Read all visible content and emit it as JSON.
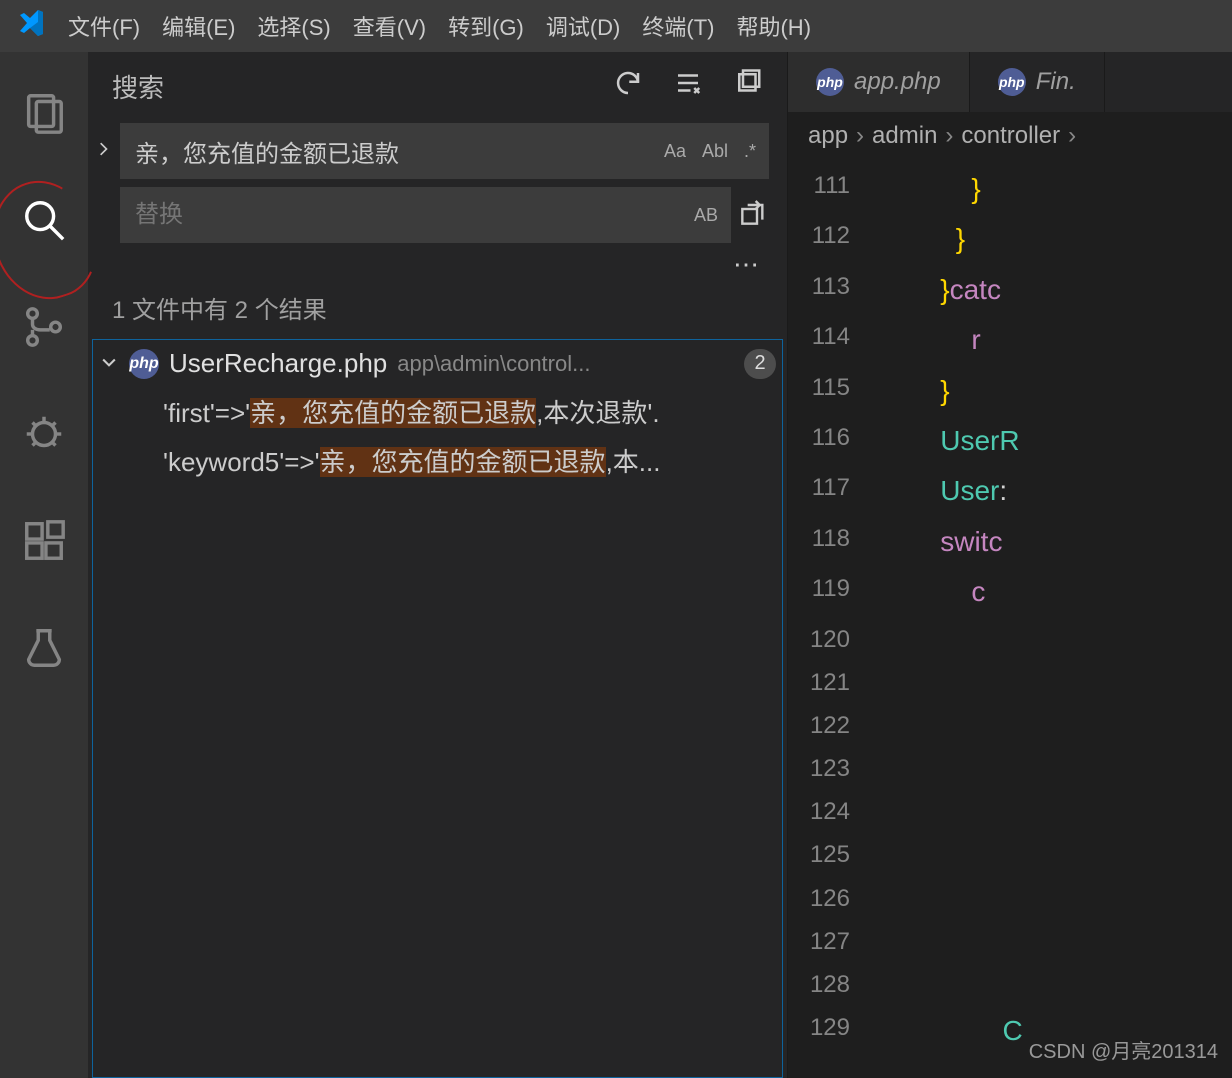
{
  "menu": {
    "file": "文件(F)",
    "edit": "编辑(E)",
    "select": "选择(S)",
    "view": "查看(V)",
    "goto": "转到(G)",
    "debug": "调试(D)",
    "terminal": "终端(T)",
    "help": "帮助(H)"
  },
  "sidebar": {
    "title": "搜索",
    "search_value": "亲，您充值的金额已退款",
    "replace_placeholder": "替换",
    "opt_case": "Aa",
    "opt_word": "Abl",
    "opt_regex": ".*",
    "opt_preserve": "AB",
    "summary": "1 文件中有 2 个结果",
    "file": {
      "name": "UserRecharge.php",
      "path": "app\\admin\\control...",
      "count": "2"
    },
    "matches": [
      {
        "pre": "'first'=>'",
        "hl": "亲，您充值的金额已退款",
        "post": ",本次退款'."
      },
      {
        "pre": "'keyword5'=>'",
        "hl": "亲，您充值的金额已退款",
        "post": ",本..."
      }
    ]
  },
  "tabs": [
    {
      "label": "app.php"
    },
    {
      "label": "Fin."
    }
  ],
  "breadcrumb": [
    "app",
    "admin",
    "controller"
  ],
  "code": [
    {
      "ln": "111",
      "html": "            <span class='y'>}</span>"
    },
    {
      "ln": "112",
      "html": "          <span class='y'>}</span>"
    },
    {
      "ln": "113",
      "html": "        <span class='y'>}</span><span class='p'>catc</span>"
    },
    {
      "ln": "114",
      "html": "            <span class='p'>r</span>"
    },
    {
      "ln": "115",
      "html": "        <span class='y'>}</span>"
    },
    {
      "ln": "116",
      "html": "        <span class='t'>UserR</span>"
    },
    {
      "ln": "117",
      "html": "        <span class='t'>User</span><span class='o'>:</span>"
    },
    {
      "ln": "118",
      "html": "        <span class='p'>switc</span>"
    },
    {
      "ln": "119",
      "html": "            <span class='p'>c</span>"
    },
    {
      "ln": "120",
      "html": ""
    },
    {
      "ln": "121",
      "html": ""
    },
    {
      "ln": "122",
      "html": ""
    },
    {
      "ln": "123",
      "html": ""
    },
    {
      "ln": "124",
      "html": ""
    },
    {
      "ln": "125",
      "html": ""
    },
    {
      "ln": "126",
      "html": ""
    },
    {
      "ln": "127",
      "html": ""
    },
    {
      "ln": "128",
      "html": ""
    },
    {
      "ln": "129",
      "html": "                <span class='t'>C</span>"
    }
  ],
  "watermark": "CSDN @月亮201314"
}
